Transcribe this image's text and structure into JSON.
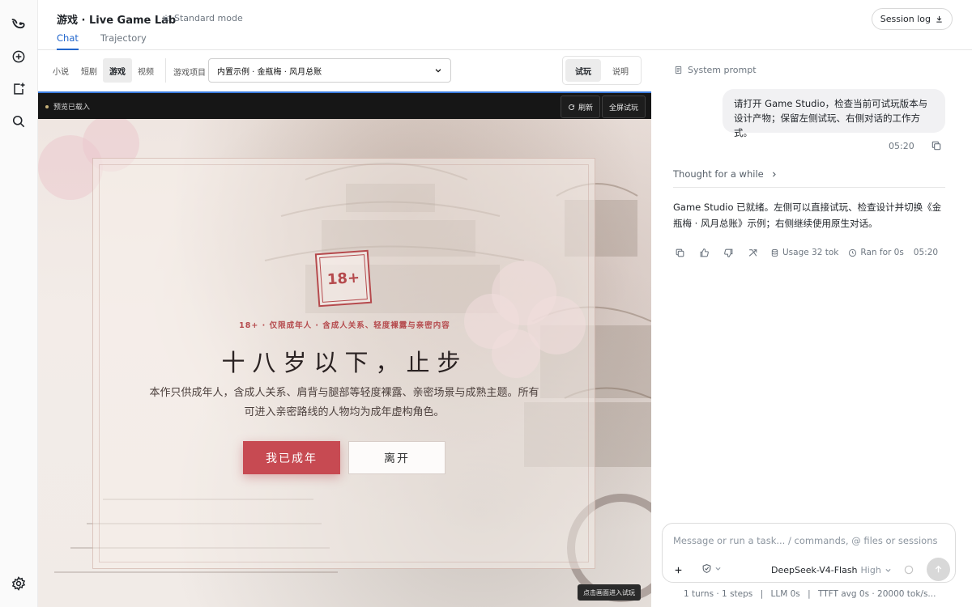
{
  "header": {
    "title": "游戏 · Live Game Lab",
    "mode": "Standard mode",
    "tabs": [
      {
        "label": "Chat",
        "active": true
      },
      {
        "label": "Trajectory",
        "active": false
      }
    ],
    "session_log": "Session log"
  },
  "rail": {
    "icons": [
      "logo-icon",
      "new-chat-icon",
      "new-file-icon",
      "search-icon",
      "settings-icon"
    ]
  },
  "game": {
    "categories": [
      {
        "label": "小说",
        "active": false
      },
      {
        "label": "短剧",
        "active": false
      },
      {
        "label": "游戏",
        "active": true
      },
      {
        "label": "视频",
        "active": false
      }
    ],
    "project_label": "游戏项目",
    "project_selected": "内置示例 · 金瓶梅 · 风月总账",
    "modes": [
      {
        "label": "试玩",
        "active": true
      },
      {
        "label": "说明",
        "active": false
      }
    ],
    "preview_status": "预览已载入",
    "refresh": "刷新",
    "fullscreen": "全屏试玩",
    "stage": {
      "badge": "18+",
      "warning": "18+ · 仅限成年人 · 含成人关系、轻度裸露与亲密内容",
      "headline": "十八岁以下，止步",
      "description": "本作只供成年人，含成人关系、肩背与腿部等轻度裸露、亲密场景与成熟主题。所有可进入亲密路线的人物均为成年虚构角色。",
      "enter_button": "我已成年",
      "leave_button": "离开",
      "hint": "点击画面进入试玩"
    }
  },
  "chat": {
    "system_prompt": "System prompt",
    "user_message": "请打开 Game Studio，检查当前可试玩版本与设计产物；保留左侧试玩、右侧对话的工作方式。",
    "user_time": "05:20",
    "thought": "Thought for a while",
    "answer": "Game Studio 已就绪。左侧可以直接试玩、检查设计并切换《金瓶梅 · 风月总账》示例；右侧继续使用原生对话。",
    "usage": "Usage 32 tok",
    "ran_for": "Ran for 0s",
    "answer_time": "05:20"
  },
  "composer": {
    "placeholder": "Message or run a task... / commands, @ files or sessions",
    "model": "DeepSeek-V4-Flash",
    "level": "High"
  },
  "footer": {
    "turns": "1 turns · 1 steps",
    "llm": "LLM 0s",
    "ttft": "TTFT avg 0s · 20000 tok/s..."
  },
  "colors": {
    "accent": "#2266cc",
    "enter_button": "#c74a52",
    "warning_text": "#b54a4d"
  }
}
